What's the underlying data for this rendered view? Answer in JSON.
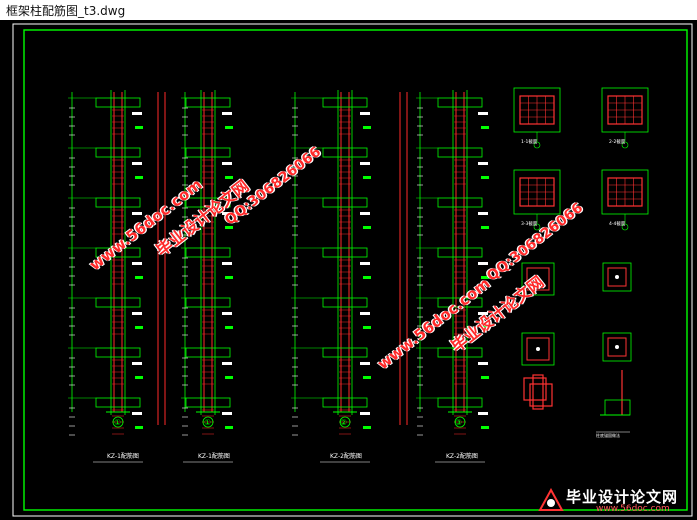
{
  "window": {
    "title": "框架柱配筋图_t3.dwg"
  },
  "drawing": {
    "column_labels": [
      "KZ-1配筋图",
      "KZ-1配筋图",
      "KZ-2配筋图",
      "KZ-2配筋图"
    ],
    "axis_marks": [
      "①",
      "①",
      "②",
      "③"
    ],
    "section_labels": [
      "1-1截面",
      "2-2截面",
      "3-3截面",
      "4-4截面"
    ],
    "detail_label": "柱底锚固做法",
    "colors": {
      "frame": "#00ff00",
      "rebar": "#ff2a2a",
      "dim": "#ffffff",
      "section_fill": "#ff3333",
      "background": "#000000"
    }
  },
  "watermarks": {
    "site_a": "www.56doc.com",
    "brand_a": "毕业设计论文网",
    "qq_a": "QQ:306826066",
    "site_b": "www.56doc.com",
    "brand_b": "毕业设计论文网",
    "qq_b": "QQ:306826066"
  },
  "logo": {
    "text": "毕业设计论文网",
    "url": "www.56doc.com"
  }
}
